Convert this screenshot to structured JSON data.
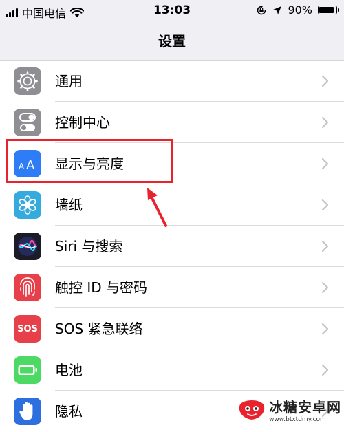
{
  "status_bar": {
    "carrier": "中国电信",
    "time": "13:03",
    "battery_percent": "90%",
    "battery_level": 0.9,
    "icons": [
      "signal-bars-icon",
      "wifi-icon",
      "rotation-lock-icon",
      "location-arrow-icon",
      "battery-icon"
    ]
  },
  "nav": {
    "title": "设置"
  },
  "settings": {
    "items": [
      {
        "label": "通用",
        "icon": "gear-icon",
        "color": "#8e8e93"
      },
      {
        "label": "控制中心",
        "icon": "toggles-icon",
        "color": "#8e8e93"
      },
      {
        "label": "显示与亮度",
        "icon": "text-size-icon",
        "color": "#2e7cf6"
      },
      {
        "label": "墙纸",
        "icon": "flower-icon",
        "color": "#35aadc"
      },
      {
        "label": "Siri 与搜索",
        "icon": "siri-icon",
        "color": "#1c1c28"
      },
      {
        "label": "触控 ID 与密码",
        "icon": "fingerprint-icon",
        "color": "#e8404a"
      },
      {
        "label": "SOS 紧急联络",
        "icon": "sos-icon",
        "color": "#e8404a",
        "icon_text": "SOS"
      },
      {
        "label": "电池",
        "icon": "battery-icon",
        "color": "#4cd964"
      },
      {
        "label": "隐私",
        "icon": "hand-icon",
        "color": "#2e6fe0"
      }
    ]
  },
  "annotation": {
    "highlight_color": "#e8232e"
  },
  "watermark": {
    "title": "冰糖安卓网",
    "url": "www.btxtdmy.com"
  }
}
